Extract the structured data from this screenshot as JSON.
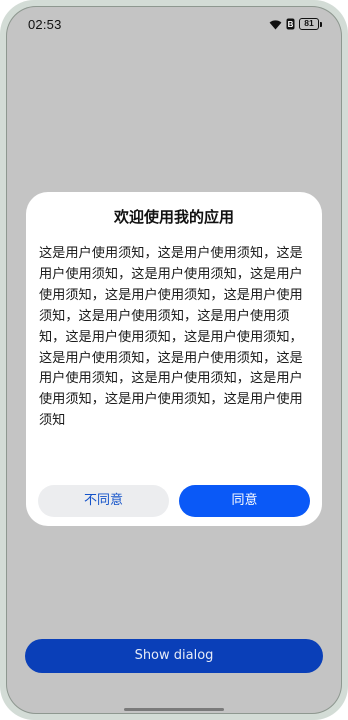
{
  "status_bar": {
    "time": "02:53",
    "battery_level": "81",
    "icons": [
      "wifi-icon",
      "notification-badge-icon",
      "battery-icon"
    ]
  },
  "dialog": {
    "title": "欢迎使用我的应用",
    "message": "这是用户使用须知，这是用户使用须知，这是用户使用须知，这是用户使用须知，这是用户使用须知，这是用户使用须知，这是用户使用须知，这是用户使用须知，这是用户使用须知，这是用户使用须知，这是用户使用须知，这是用户使用须知，这是用户使用须知，这是用户使用须知，这是用户使用须知，这是用户使用须知，这是用户使用须知，这是用户使用须知",
    "cancel_label": "不同意",
    "confirm_label": "同意"
  },
  "main": {
    "show_dialog_label": "Show dialog"
  },
  "colors": {
    "primary": "#0a59f7",
    "show_button": "#0a3fb8",
    "scrim": "#c4c4c4",
    "cancel_text": "#1453c9"
  }
}
